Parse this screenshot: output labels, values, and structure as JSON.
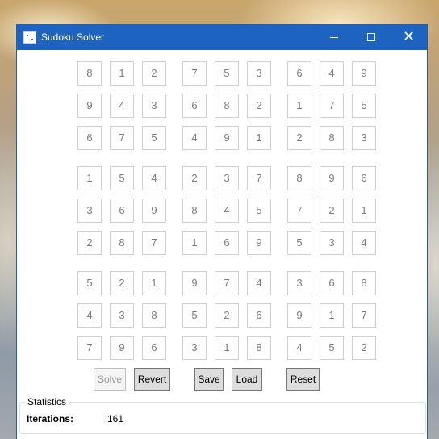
{
  "window": {
    "title": "Sudoku Solver",
    "controls": {
      "minimize_icon": "minimize-icon",
      "maximize_icon": "maximize-icon",
      "close_icon": "close-icon"
    },
    "accent_color": "#1f63c0"
  },
  "grid": [
    [
      "8",
      "1",
      "2",
      "7",
      "5",
      "3",
      "6",
      "4",
      "9"
    ],
    [
      "9",
      "4",
      "3",
      "6",
      "8",
      "2",
      "1",
      "7",
      "5"
    ],
    [
      "6",
      "7",
      "5",
      "4",
      "9",
      "1",
      "2",
      "8",
      "3"
    ],
    [
      "1",
      "5",
      "4",
      "2",
      "3",
      "7",
      "8",
      "9",
      "6"
    ],
    [
      "3",
      "6",
      "9",
      "8",
      "4",
      "5",
      "7",
      "2",
      "1"
    ],
    [
      "2",
      "8",
      "7",
      "1",
      "6",
      "9",
      "5",
      "3",
      "4"
    ],
    [
      "5",
      "2",
      "1",
      "9",
      "7",
      "4",
      "3",
      "6",
      "8"
    ],
    [
      "4",
      "3",
      "8",
      "5",
      "2",
      "6",
      "9",
      "1",
      "7"
    ],
    [
      "7",
      "9",
      "6",
      "3",
      "1",
      "8",
      "4",
      "5",
      "2"
    ]
  ],
  "buttons": {
    "solve": {
      "label": "Solve",
      "enabled": false
    },
    "revert": {
      "label": "Revert",
      "enabled": true
    },
    "save": {
      "label": "Save",
      "enabled": true
    },
    "load": {
      "label": "Load",
      "enabled": true
    },
    "reset": {
      "label": "Reset",
      "enabled": true
    }
  },
  "statistics": {
    "title": "Statistics",
    "iterations_label": "Iterations:",
    "iterations_value": "161"
  }
}
